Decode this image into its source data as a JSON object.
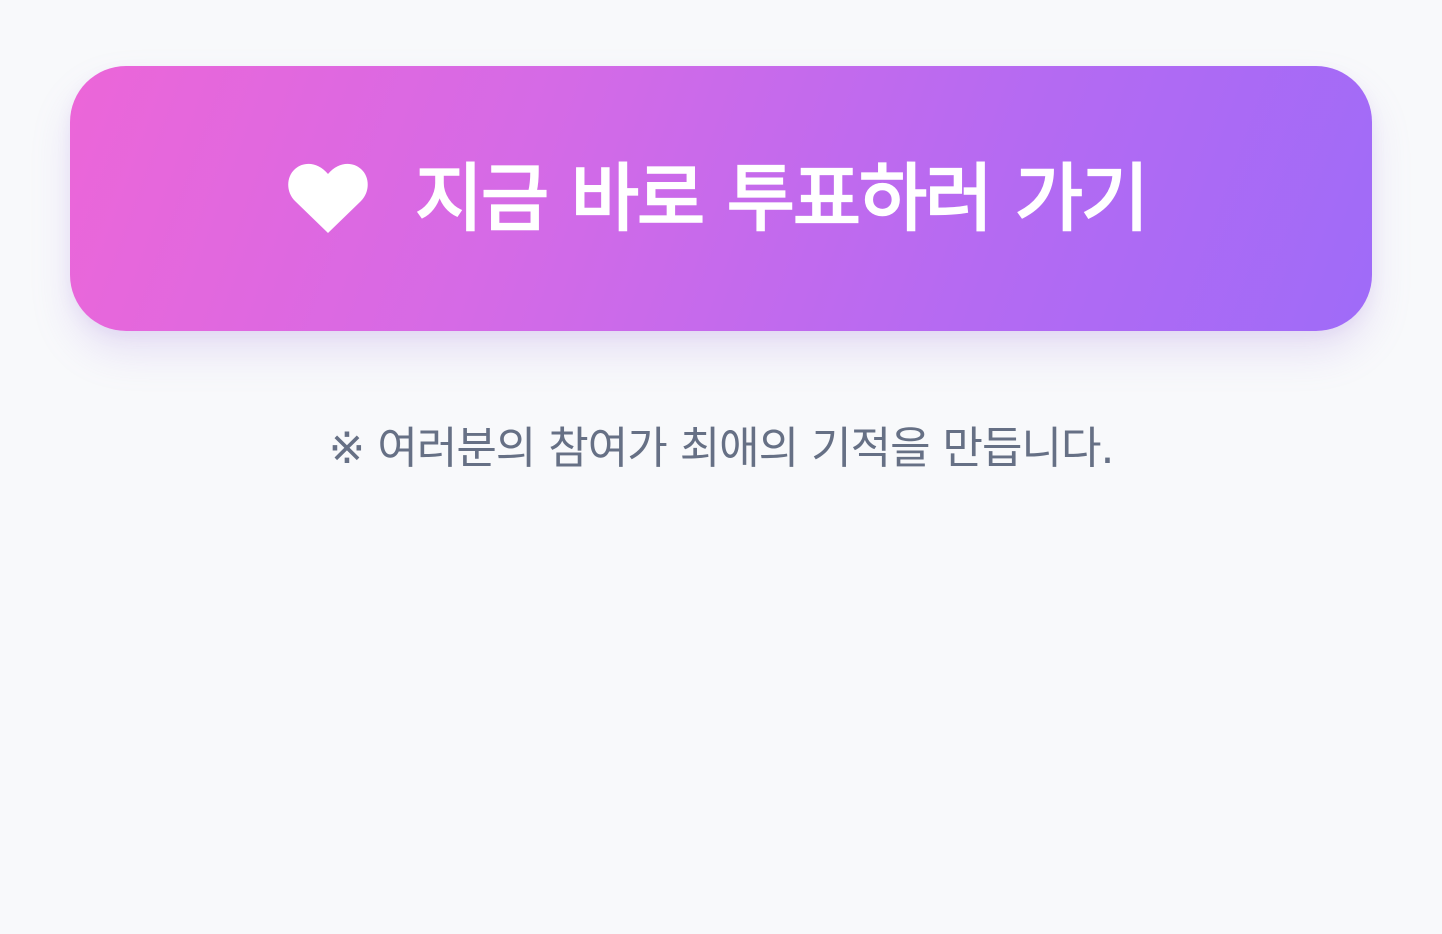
{
  "vote_button": {
    "icon": "heart-icon",
    "label": "지금 바로 투표하러 가기",
    "gradient_start": "#ec66d8",
    "gradient_end": "#9f6bf8"
  },
  "footer_note": {
    "text": "※ 여러분의 참여가 최애의 기적을 만듭니다."
  }
}
